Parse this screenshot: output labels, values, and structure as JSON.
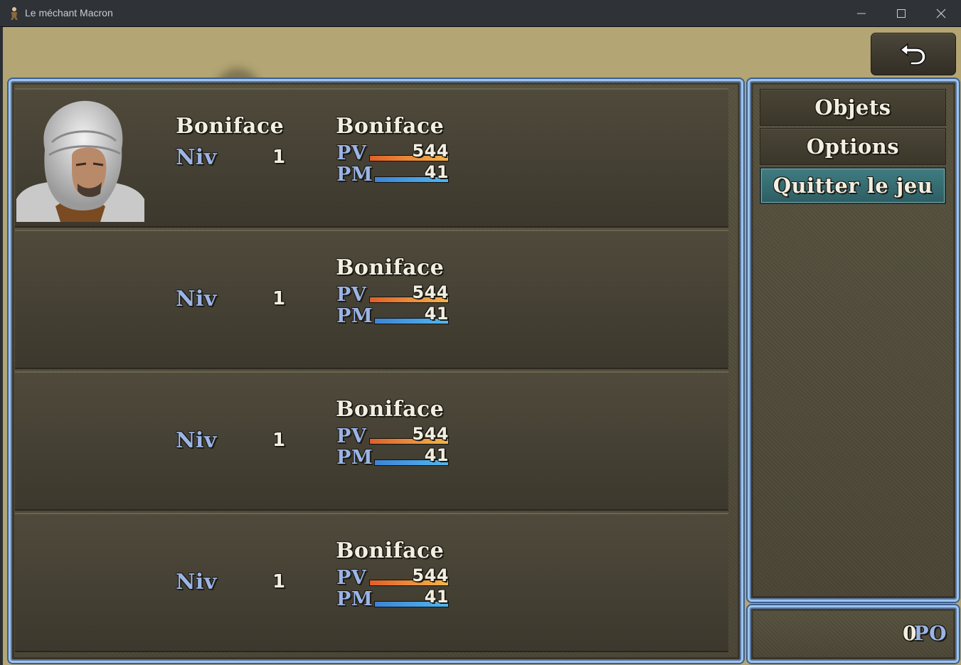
{
  "window": {
    "title": "Le méchant Macron"
  },
  "menu": {
    "commands": [
      {
        "label": "Objets",
        "selected": false
      },
      {
        "label": "Options",
        "selected": false
      },
      {
        "label": "Quitter le jeu",
        "selected": true
      }
    ],
    "gold": {
      "value": "0",
      "unit": "PO"
    }
  },
  "labels": {
    "level": "Niv",
    "hp": "PV",
    "mp": "PM"
  },
  "party": [
    {
      "name": "Boniface",
      "class": "Boniface",
      "level": "1",
      "hp": "544",
      "mp": "41",
      "hp_rate": 1,
      "mp_rate": 1,
      "has_portrait": true
    },
    {
      "name": "",
      "class": "Boniface",
      "level": "1",
      "hp": "544",
      "mp": "41",
      "hp_rate": 1,
      "mp_rate": 1,
      "has_portrait": false
    },
    {
      "name": "",
      "class": "Boniface",
      "level": "1",
      "hp": "544",
      "mp": "41",
      "hp_rate": 1,
      "mp_rate": 1,
      "has_portrait": false
    },
    {
      "name": "",
      "class": "Boniface",
      "level": "1",
      "hp": "544",
      "mp": "41",
      "hp_rate": 1,
      "mp_rate": 1,
      "has_portrait": false
    }
  ]
}
